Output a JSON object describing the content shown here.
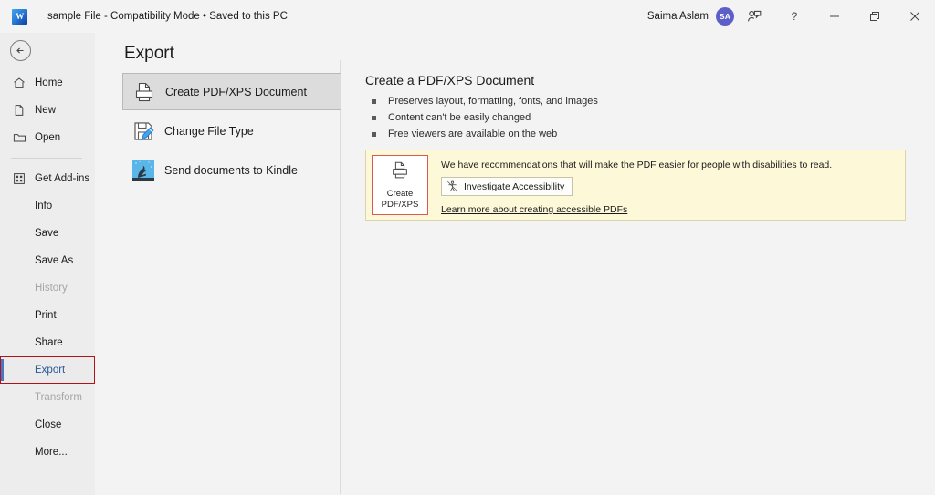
{
  "titlebar": {
    "app_icon": "word-logo-icon",
    "document_title": "sample File  -  Compatibility Mode • Saved to this PC",
    "user_name": "Saima Aslam",
    "avatar_initials": "SA",
    "buttons": [
      {
        "name": "share-person-icon",
        "label": ""
      },
      {
        "name": "help-icon",
        "label": "?"
      },
      {
        "name": "minimize-icon",
        "label": ""
      },
      {
        "name": "restore-icon",
        "label": ""
      },
      {
        "name": "close-icon",
        "label": ""
      }
    ]
  },
  "sidebar": {
    "back_label": "",
    "items": [
      {
        "label": "Home",
        "icon": "home-icon",
        "state": "normal",
        "indent": false
      },
      {
        "label": "New",
        "icon": "new-document-icon",
        "state": "normal",
        "indent": false
      },
      {
        "label": "Open",
        "icon": "open-folder-icon",
        "state": "normal",
        "indent": false
      },
      {
        "label": "Get Add-ins",
        "icon": "add-ins-grid-icon",
        "state": "normal",
        "indent": false
      },
      {
        "label": "Info",
        "icon": "",
        "state": "normal",
        "indent": true
      },
      {
        "label": "Save",
        "icon": "",
        "state": "normal",
        "indent": true
      },
      {
        "label": "Save As",
        "icon": "",
        "state": "normal",
        "indent": true
      },
      {
        "label": "History",
        "icon": "",
        "state": "disabled",
        "indent": true
      },
      {
        "label": "Print",
        "icon": "",
        "state": "normal",
        "indent": true
      },
      {
        "label": "Share",
        "icon": "",
        "state": "normal",
        "indent": true
      },
      {
        "label": "Export",
        "icon": "",
        "state": "selected",
        "indent": true
      },
      {
        "label": "Transform",
        "icon": "",
        "state": "disabled",
        "indent": true
      },
      {
        "label": "Close",
        "icon": "",
        "state": "normal",
        "indent": true
      },
      {
        "label": "More...",
        "icon": "",
        "state": "normal",
        "indent": true
      }
    ]
  },
  "main": {
    "page_title": "Export",
    "tiles": [
      {
        "label": "Create PDF/XPS Document",
        "icon": "pdf-printer-icon",
        "active": true
      },
      {
        "label": "Change File Type",
        "icon": "change-file-type-icon",
        "active": false
      },
      {
        "label": "Send documents to Kindle",
        "icon": "kindle-icon",
        "active": false
      }
    ],
    "detail": {
      "heading": "Create a PDF/XPS Document",
      "bullets": [
        "Preserves layout, formatting, fonts, and images",
        "Content can't be easily changed",
        "Free viewers are available on the web"
      ]
    },
    "notice": {
      "create_button_line1": "Create",
      "create_button_line2": "PDF/XPS",
      "message": "We have recommendations that will make the PDF easier for people with disabilities to read.",
      "investigate_label": "Investigate Accessibility",
      "link_label": "Learn more about creating accessible PDFs"
    }
  },
  "colors": {
    "accent_blue": "#2b579a",
    "selection_red": "#b01217",
    "notice_background": "#fdf8d8",
    "notice_border": "#d9d4ae",
    "create_button_border": "#e0574b",
    "avatar_background": "#5b5fc7",
    "sidebar_background": "#ededed",
    "main_background": "#f3f3f3"
  }
}
